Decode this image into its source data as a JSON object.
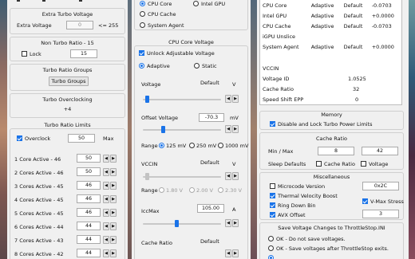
{
  "col1": {
    "extra_turbo_voltage": {
      "title": "Extra Turbo Voltage",
      "label": "Extra Voltage",
      "value": "0",
      "suffix": "<= 255"
    },
    "non_turbo_ratio": {
      "title": "Non Turbo Ratio - 15",
      "lock_label": "Lock",
      "value": "15"
    },
    "turbo_ratio_groups": {
      "title": "Turbo Ratio Groups",
      "button": "Turbo Groups"
    },
    "turbo_overclocking": {
      "title": "Turbo Overclocking",
      "value": "+4"
    },
    "turbo_ratio_limits": {
      "title": "Turbo Ratio Limits",
      "overclock_label": "Overclock",
      "overclock_value": "50",
      "max_label": "Max",
      "rows": [
        {
          "label": "1 Core  Active - 46",
          "value": "50"
        },
        {
          "label": "2 Cores Active - 46",
          "value": "50"
        },
        {
          "label": "3 Cores Active - 45",
          "value": "46"
        },
        {
          "label": "4 Cores Active - 45",
          "value": "46"
        },
        {
          "label": "5 Cores Active - 45",
          "value": "46"
        },
        {
          "label": "6 Cores Active - 44",
          "value": "44"
        },
        {
          "label": "7 Cores Active - 43",
          "value": "44"
        },
        {
          "label": "8 Cores Active - 42",
          "value": "44"
        }
      ]
    }
  },
  "col2": {
    "targets": {
      "cpu_core": "CPU Core",
      "intel_gpu": "Intel GPU",
      "cpu_cache": "CPU Cache",
      "system_agent": "System Agent"
    },
    "core_voltage": {
      "title": "CPU Core Voltage",
      "unlock_label": "Unlock Adjustable Voltage",
      "adaptive_label": "Adaptive",
      "static_label": "Static",
      "voltage_label": "Voltage",
      "voltage_mode": "Default",
      "voltage_unit": "V",
      "offset_label": "Offset Voltage",
      "offset_value": "-70.3",
      "offset_unit": "mV",
      "range_label": "Range",
      "ranges": [
        "125 mV",
        "250 mV",
        "1000 mV"
      ],
      "vccin_label": "VCCIN",
      "vccin_mode": "Default",
      "vccin_unit": "V",
      "vccin_ranges": [
        "1.80 V",
        "2.00 V",
        "2.30 V"
      ],
      "iccmax_label": "IccMax",
      "iccmax_value": "105.00",
      "iccmax_unit": "A",
      "cache_ratio_label": "Cache Ratio",
      "cache_ratio_mode": "Default"
    }
  },
  "col3": {
    "info_rows": [
      {
        "name": "CPU Core",
        "mode": "Adaptive",
        "state": "Default",
        "value": "-0.0703"
      },
      {
        "name": "Intel GPU",
        "mode": "Adaptive",
        "state": "Default",
        "value": "+0.0000"
      },
      {
        "name": "CPU Cache",
        "mode": "Adaptive",
        "state": "Default",
        "value": "-0.0703"
      },
      {
        "name": "iGPU Unslice",
        "mode": "",
        "state": "",
        "value": ""
      },
      {
        "name": "System Agent",
        "mode": "Adaptive",
        "state": "Default",
        "value": "+0.0000"
      }
    ],
    "stat_rows": [
      {
        "name": "VCCIN",
        "value": ""
      },
      {
        "name": "Voltage ID",
        "value": "1.0525"
      },
      {
        "name": "Cache Ratio",
        "value": "32"
      },
      {
        "name": "Speed Shift EPP",
        "value": "0"
      }
    ],
    "memory": {
      "title": "Memory",
      "lock_label": "Disable and Lock Turbo Power Limits"
    },
    "cache_ratio": {
      "title": "Cache Ratio",
      "minmax_label": "Min / Max",
      "min": "8",
      "max": "42",
      "sleep_defaults": "Sleep Defaults",
      "cache_ratio_cb": "Cache Ratio",
      "voltage_cb": "Voltage"
    },
    "misc": {
      "title": "Miscellaneous",
      "microcode_label": "Microcode Version",
      "microcode_value": "0x2C",
      "tvb_label": "Thermal Velocity Boost",
      "ring_down_label": "Ring Down Bin",
      "vmax_label": "V-Max Stress",
      "avx_label": "AVX Offset",
      "avx_value": "3"
    },
    "save": {
      "title": "Save Voltage Changes to ThrottleStop.INI",
      "opt1": "OK - Do not save voltages.",
      "opt2": "OK - Save voltages after ThrottleStop exits."
    }
  }
}
